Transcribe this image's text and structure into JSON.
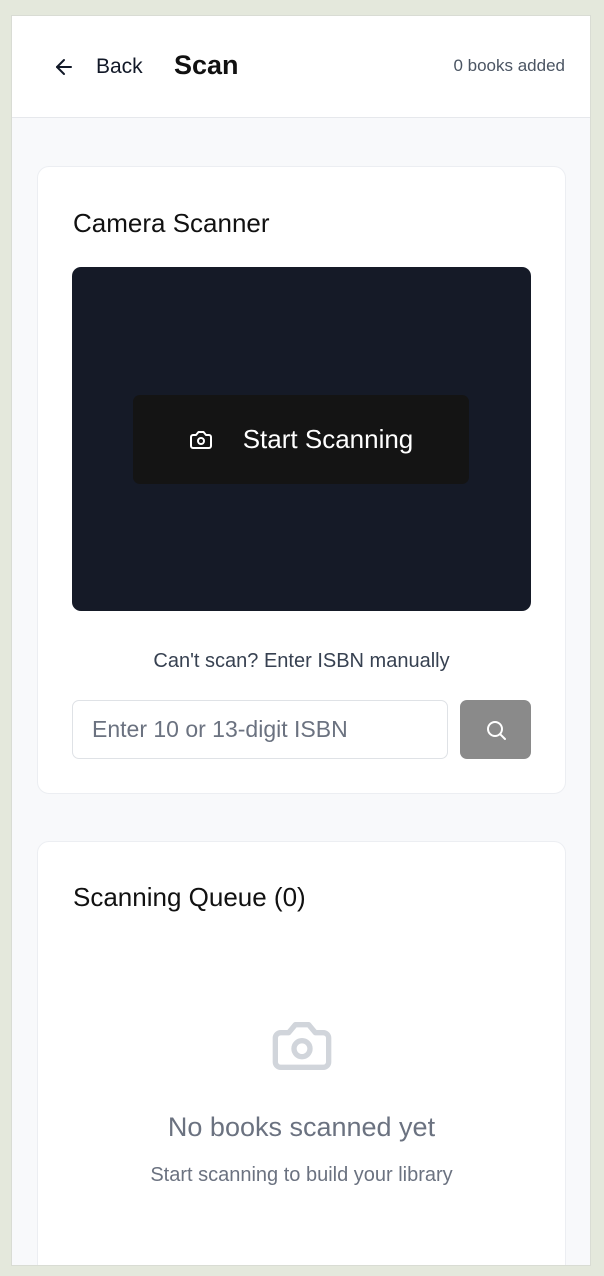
{
  "header": {
    "back_label": "Back",
    "title": "Scan",
    "count_text": "0 books added"
  },
  "scanner": {
    "title": "Camera Scanner",
    "start_label": "Start Scanning",
    "manual_hint": "Can't scan? Enter ISBN manually",
    "isbn_placeholder": "Enter 10 or 13-digit ISBN",
    "isbn_value": ""
  },
  "queue": {
    "title": "Scanning Queue (0)",
    "empty_title": "No books scanned yet",
    "empty_subtitle": "Start scanning to build your library"
  },
  "icons": {
    "back": "arrow-left-icon",
    "camera": "camera-icon",
    "search": "search-icon",
    "empty": "camera-icon"
  },
  "colors": {
    "viewport_bg": "#151a27",
    "start_button_bg": "#141414",
    "search_button_bg": "#8a8a8a",
    "muted_text": "#6b7280"
  }
}
